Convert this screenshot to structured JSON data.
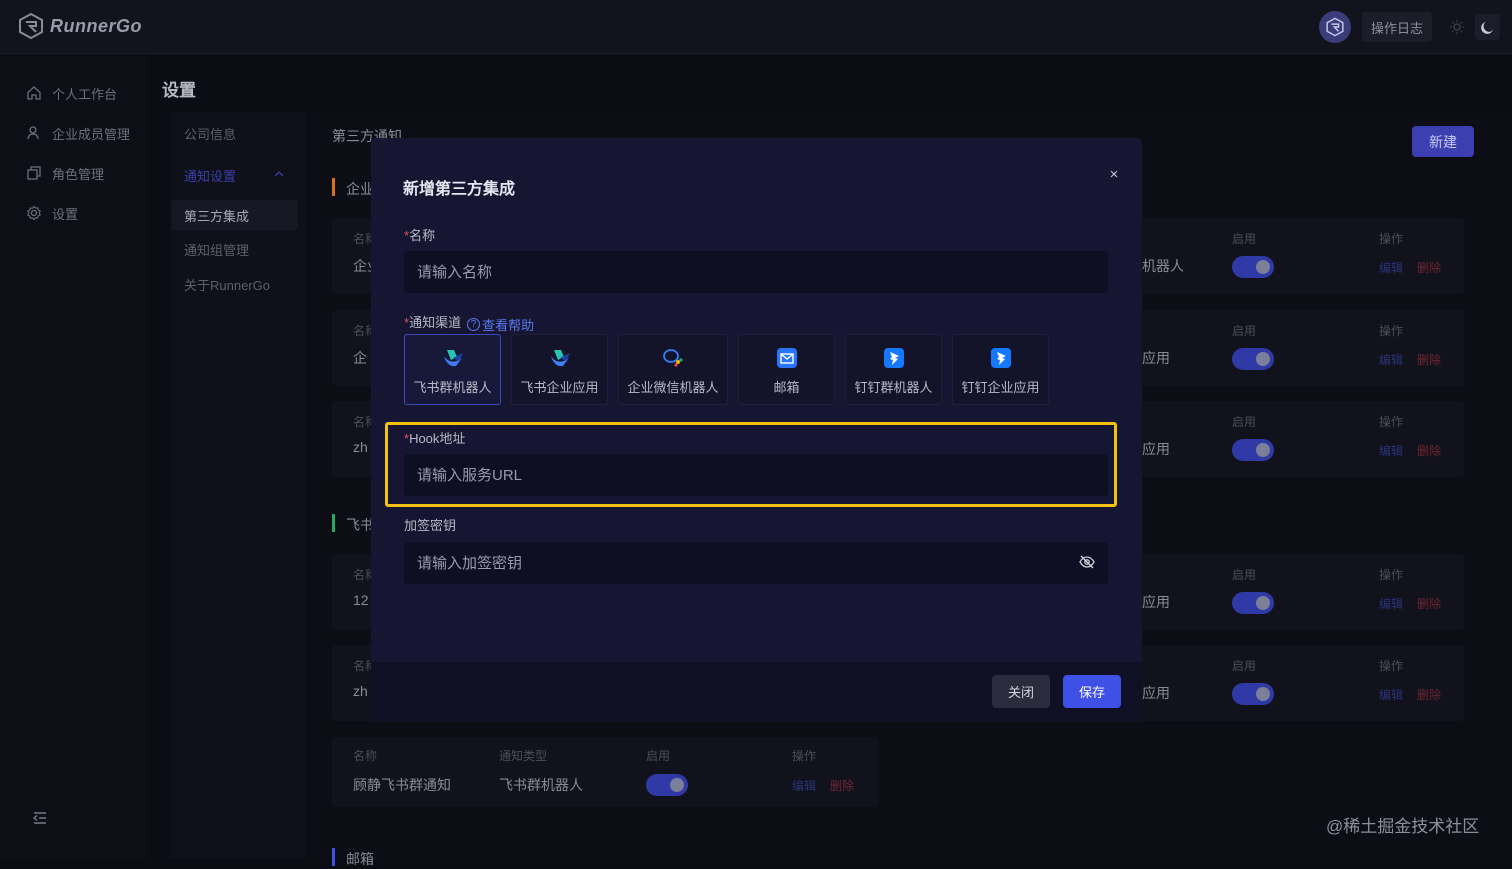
{
  "app": {
    "name": "RunnerGo"
  },
  "topbar": {
    "log_label": "操作日志"
  },
  "sidebar": {
    "items": [
      {
        "label": "个人工作台",
        "icon": "home-icon"
      },
      {
        "label": "企业成员管理",
        "icon": "user-icon"
      },
      {
        "label": "角色管理",
        "icon": "copy-icon"
      },
      {
        "label": "设置",
        "icon": "gear-icon"
      }
    ]
  },
  "page": {
    "title": "设置",
    "subtitle": "第三方通知",
    "new_button": "新建"
  },
  "subnav": {
    "items": [
      "公司信息",
      "通知设置",
      "第三方集成",
      "通知组管理",
      "关于RunnerGo"
    ]
  },
  "sections": [
    {
      "label": "企业",
      "color": "#d8701f"
    },
    {
      "label": "飞书",
      "color": "#2aa862"
    },
    {
      "label": "邮箱",
      "color": "#3f50e6"
    }
  ],
  "table": {
    "headers": {
      "name": "名称",
      "type": "通知类型",
      "enabled": "启用",
      "actions": "操作"
    },
    "edit": "编辑",
    "delete": "删除",
    "rows": [
      {
        "name": "企业",
        "type": "机器人"
      },
      {
        "name": "企",
        "type": "应用"
      },
      {
        "name": "zh",
        "type": "应用"
      },
      {
        "name": "12",
        "type": "应用"
      },
      {
        "name": "zh",
        "type": "应用"
      }
    ],
    "bottom_row": {
      "name": "顾静飞书群通知",
      "type": "飞书群机器人"
    }
  },
  "modal": {
    "title": "新增第三方集成",
    "close_icon": "×",
    "name_label": "名称",
    "name_placeholder": "请输入名称",
    "channel_label": "通知渠道",
    "help_link": "查看帮助",
    "channels": [
      {
        "label": "飞书群机器人",
        "icon": "feishu-icon"
      },
      {
        "label": "飞书企业应用",
        "icon": "feishu-icon"
      },
      {
        "label": "企业微信机器人",
        "icon": "wecom-icon"
      },
      {
        "label": "邮箱",
        "icon": "mail-icon"
      },
      {
        "label": "钉钉群机器人",
        "icon": "dingtalk-icon"
      },
      {
        "label": "钉钉企业应用",
        "icon": "dingtalk-icon"
      }
    ],
    "selected_channel": "飞书群机器人",
    "hook_label": "Hook地址",
    "hook_placeholder": "请输入服务URL",
    "secret_label": "加签密钥",
    "secret_placeholder": "请输入加签密钥",
    "close_button": "关闭",
    "save_button": "保存"
  },
  "watermark": "@稀土掘金技术社区",
  "colors": {
    "accent": "#3f50e6",
    "highlight": "#f2c20f",
    "required": "#e0535f"
  }
}
